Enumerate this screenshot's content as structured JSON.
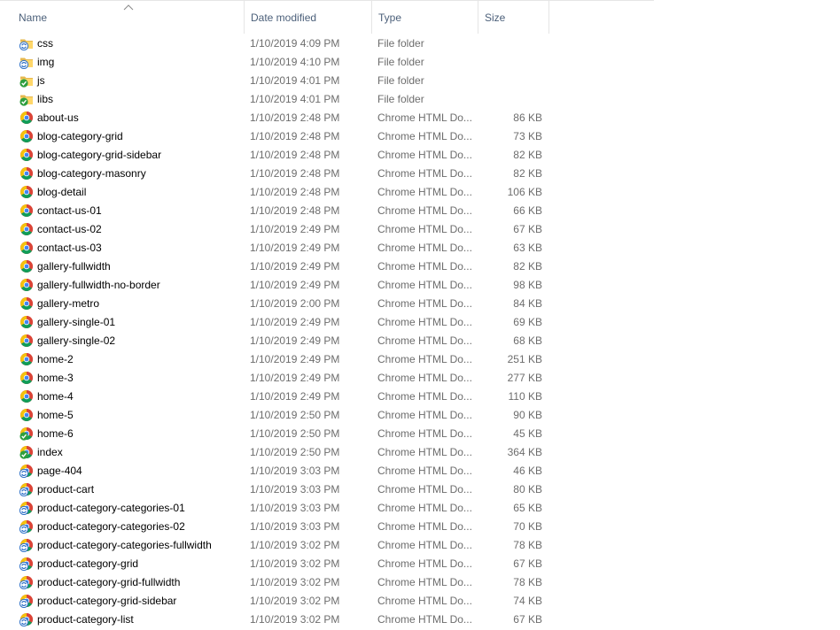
{
  "columns": {
    "name": "Name",
    "date": "Date modified",
    "type": "Type",
    "size": "Size"
  },
  "files": [
    {
      "name": "css",
      "date": "1/10/2019 4:09 PM",
      "type": "File folder",
      "size": "",
      "icon": "folder-sync-icon"
    },
    {
      "name": "img",
      "date": "1/10/2019 4:10 PM",
      "type": "File folder",
      "size": "",
      "icon": "folder-sync-icon"
    },
    {
      "name": "js",
      "date": "1/10/2019 4:01 PM",
      "type": "File folder",
      "size": "",
      "icon": "folder-synced-icon"
    },
    {
      "name": "libs",
      "date": "1/10/2019 4:01 PM",
      "type": "File folder",
      "size": "",
      "icon": "folder-synced-icon"
    },
    {
      "name": "about-us",
      "date": "1/10/2019 2:48 PM",
      "type": "Chrome HTML Do...",
      "size": "86 KB",
      "icon": "chrome-html-icon"
    },
    {
      "name": "blog-category-grid",
      "date": "1/10/2019 2:48 PM",
      "type": "Chrome HTML Do...",
      "size": "73 KB",
      "icon": "chrome-html-icon"
    },
    {
      "name": "blog-category-grid-sidebar",
      "date": "1/10/2019 2:48 PM",
      "type": "Chrome HTML Do...",
      "size": "82 KB",
      "icon": "chrome-html-icon"
    },
    {
      "name": "blog-category-masonry",
      "date": "1/10/2019 2:48 PM",
      "type": "Chrome HTML Do...",
      "size": "82 KB",
      "icon": "chrome-html-icon"
    },
    {
      "name": "blog-detail",
      "date": "1/10/2019 2:48 PM",
      "type": "Chrome HTML Do...",
      "size": "106 KB",
      "icon": "chrome-html-icon"
    },
    {
      "name": "contact-us-01",
      "date": "1/10/2019 2:48 PM",
      "type": "Chrome HTML Do...",
      "size": "66 KB",
      "icon": "chrome-html-icon"
    },
    {
      "name": "contact-us-02",
      "date": "1/10/2019 2:49 PM",
      "type": "Chrome HTML Do...",
      "size": "67 KB",
      "icon": "chrome-html-icon"
    },
    {
      "name": "contact-us-03",
      "date": "1/10/2019 2:49 PM",
      "type": "Chrome HTML Do...",
      "size": "63 KB",
      "icon": "chrome-html-icon"
    },
    {
      "name": "gallery-fullwidth",
      "date": "1/10/2019 2:49 PM",
      "type": "Chrome HTML Do...",
      "size": "82 KB",
      "icon": "chrome-html-icon"
    },
    {
      "name": "gallery-fullwidth-no-border",
      "date": "1/10/2019 2:49 PM",
      "type": "Chrome HTML Do...",
      "size": "98 KB",
      "icon": "chrome-html-icon"
    },
    {
      "name": "gallery-metro",
      "date": "1/10/2019 2:00 PM",
      "type": "Chrome HTML Do...",
      "size": "84 KB",
      "icon": "chrome-html-icon"
    },
    {
      "name": "gallery-single-01",
      "date": "1/10/2019 2:49 PM",
      "type": "Chrome HTML Do...",
      "size": "69 KB",
      "icon": "chrome-html-icon"
    },
    {
      "name": "gallery-single-02",
      "date": "1/10/2019 2:49 PM",
      "type": "Chrome HTML Do...",
      "size": "68 KB",
      "icon": "chrome-html-icon"
    },
    {
      "name": "home-2",
      "date": "1/10/2019 2:49 PM",
      "type": "Chrome HTML Do...",
      "size": "251 KB",
      "icon": "chrome-html-icon"
    },
    {
      "name": "home-3",
      "date": "1/10/2019 2:49 PM",
      "type": "Chrome HTML Do...",
      "size": "277 KB",
      "icon": "chrome-html-icon"
    },
    {
      "name": "home-4",
      "date": "1/10/2019 2:49 PM",
      "type": "Chrome HTML Do...",
      "size": "110 KB",
      "icon": "chrome-html-icon"
    },
    {
      "name": "home-5",
      "date": "1/10/2019 2:50 PM",
      "type": "Chrome HTML Do...",
      "size": "90 KB",
      "icon": "chrome-html-icon"
    },
    {
      "name": "home-6",
      "date": "1/10/2019 2:50 PM",
      "type": "Chrome HTML Do...",
      "size": "45 KB",
      "icon": "chrome-html-synced-icon"
    },
    {
      "name": "index",
      "date": "1/10/2019 2:50 PM",
      "type": "Chrome HTML Do...",
      "size": "364 KB",
      "icon": "chrome-html-synced-icon"
    },
    {
      "name": "page-404",
      "date": "1/10/2019 3:03 PM",
      "type": "Chrome HTML Do...",
      "size": "46 KB",
      "icon": "chrome-html-sync-icon"
    },
    {
      "name": "product-cart",
      "date": "1/10/2019 3:03 PM",
      "type": "Chrome HTML Do...",
      "size": "80 KB",
      "icon": "chrome-html-sync-icon"
    },
    {
      "name": "product-category-categories-01",
      "date": "1/10/2019 3:03 PM",
      "type": "Chrome HTML Do...",
      "size": "65 KB",
      "icon": "chrome-html-sync-icon"
    },
    {
      "name": "product-category-categories-02",
      "date": "1/10/2019 3:03 PM",
      "type": "Chrome HTML Do...",
      "size": "70 KB",
      "icon": "chrome-html-sync-icon"
    },
    {
      "name": "product-category-categories-fullwidth",
      "date": "1/10/2019 3:02 PM",
      "type": "Chrome HTML Do...",
      "size": "78 KB",
      "icon": "chrome-html-sync-icon"
    },
    {
      "name": "product-category-grid",
      "date": "1/10/2019 3:02 PM",
      "type": "Chrome HTML Do...",
      "size": "67 KB",
      "icon": "chrome-html-sync-icon"
    },
    {
      "name": "product-category-grid-fullwidth",
      "date": "1/10/2019 3:02 PM",
      "type": "Chrome HTML Do...",
      "size": "78 KB",
      "icon": "chrome-html-sync-icon"
    },
    {
      "name": "product-category-grid-sidebar",
      "date": "1/10/2019 3:02 PM",
      "type": "Chrome HTML Do...",
      "size": "74 KB",
      "icon": "chrome-html-sync-icon"
    },
    {
      "name": "product-category-list",
      "date": "1/10/2019 3:02 PM",
      "type": "Chrome HTML Do...",
      "size": "67 KB",
      "icon": "chrome-html-sync-icon"
    }
  ]
}
